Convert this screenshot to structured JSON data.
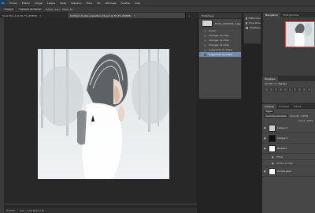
{
  "menubar": {
    "logo": "Ps",
    "items": [
      "Fichier",
      "Édition",
      "Image",
      "Calque",
      "Texte",
      "Sélection",
      "Filtre",
      "3D",
      "Affichage",
      "Fenêtre",
      "Aide"
    ]
  },
  "options": {
    "preset": "Calque",
    "transform": "Options de transf.",
    "align_label": "Sélect. auto",
    "mode": "Mode 3D"
  },
  "tabs": [
    {
      "label": "Sans titre-1 @ 66,7% (RVB/8)",
      "active": false
    },
    {
      "label": "Untitled-double exposition-04.psd @ 33,3% (RVB/8)",
      "active": true
    },
    {
      "label": "...",
      "active": false
    }
  ],
  "history": {
    "title": "Historique",
    "snapshot": "Photo_1000032_2.jpg",
    "items": [
      "Ouvrir",
      "Changer de rotat.",
      "Changer de rotat.",
      "Changer de rotat.",
      "Supprimer le calque",
      "Supprimer le calque"
    ],
    "selected_index": 5
  },
  "mini_dock": [
    {
      "label": "Historique",
      "icon": "history-icon"
    },
    {
      "label": "Propriétés",
      "icon": "properties-icon"
    },
    {
      "label": "Réglages",
      "icon": "adjustments-icon"
    }
  ],
  "right_tabs": [
    "Navigation",
    "Histogramme"
  ],
  "adjustments": {
    "tabs": [
      "Réglages"
    ],
    "prompt": "Ajouter un réglage"
  },
  "layers": {
    "tabs": [
      "Calques",
      "Couches",
      "Tracés"
    ],
    "kind_label": "Type",
    "blend_mode": "Lumière tamisée",
    "opacity_label": "Opacité : 100%",
    "fill_label": "Fond : 100%",
    "items": [
      {
        "name": "Calque 2",
        "thumb": "photo",
        "sub": false
      },
      {
        "name": "Calque 1",
        "thumb": "dark",
        "sub": false
      },
      {
        "name": "Niveaux",
        "thumb": "white",
        "sub": false
      },
      {
        "name": "Effets",
        "thumb": "none",
        "sub": true
      },
      {
        "name": "Ombre portée",
        "thumb": "none",
        "sub": true
      },
      {
        "name": "Arrière-plan",
        "thumb": "white",
        "sub": false
      }
    ]
  },
  "status": {
    "zoom": "33,33%",
    "doc": "Doc : 5,93 M/33,2 M"
  },
  "colors": {
    "selection": "#6f8bb0",
    "panel": "#474747",
    "canvas_bg": "#282828"
  }
}
